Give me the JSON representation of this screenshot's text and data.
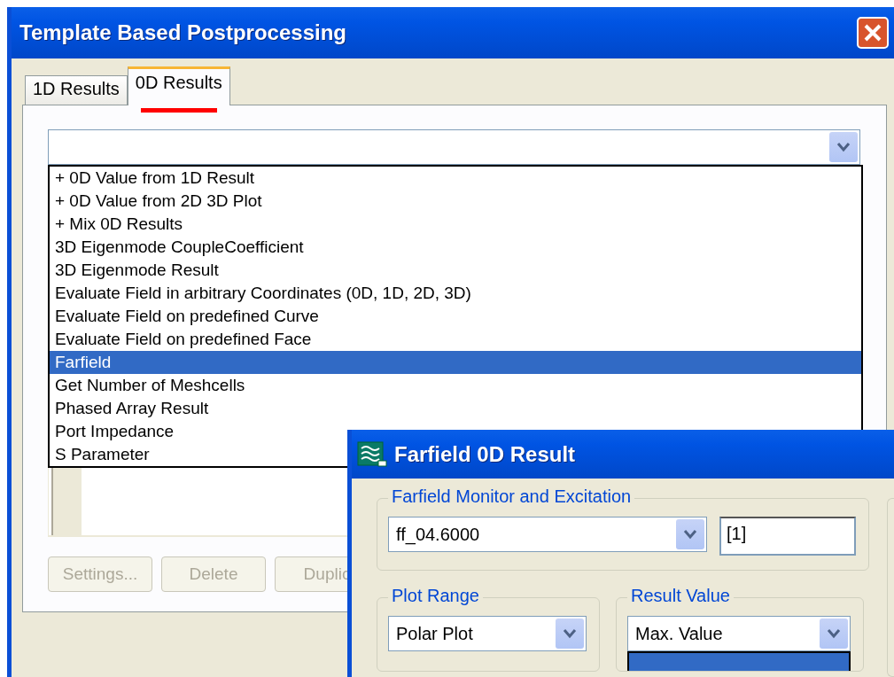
{
  "window": {
    "title": "Template Based Postprocessing"
  },
  "tabs": [
    {
      "label": "1D Results",
      "selected": false,
      "marked": false
    },
    {
      "label": "0D Results",
      "selected": true,
      "marked": true
    }
  ],
  "template_combo": {
    "expanded": true,
    "items": [
      {
        "label": "+ 0D Value from 1D Result",
        "selected": false
      },
      {
        "label": "+ 0D Value from 2D 3D Plot",
        "selected": false
      },
      {
        "label": "+ Mix 0D Results",
        "selected": false
      },
      {
        "label": "3D Eigenmode CoupleCoefficient",
        "selected": false
      },
      {
        "label": "3D Eigenmode Result",
        "selected": false
      },
      {
        "label": "Evaluate Field in arbitrary Coordinates (0D, 1D, 2D, 3D)",
        "selected": false
      },
      {
        "label": "Evaluate Field on predefined Curve",
        "selected": false
      },
      {
        "label": "Evaluate Field on predefined Face",
        "selected": false
      },
      {
        "label": "Farfield",
        "selected": true
      },
      {
        "label": "Get Number of Meshcells",
        "selected": false
      },
      {
        "label": "Phased Array Result",
        "selected": false
      },
      {
        "label": "Port Impedance",
        "selected": false
      },
      {
        "label": "S Parameter",
        "selected": false
      }
    ]
  },
  "buttons": [
    {
      "label": "Settings...",
      "disabled": true
    },
    {
      "label": "Delete",
      "disabled": true
    },
    {
      "label": "Duplic",
      "disabled": true
    }
  ],
  "farfield_dialog": {
    "title": "Farfield 0D Result",
    "monitor_group": {
      "label": "Farfield Monitor and Excitation",
      "monitor": "ff_04.6000",
      "excitation": "[1]"
    },
    "plot_range_group": {
      "label": "Plot Range",
      "value": "Polar Plot"
    },
    "result_value_group": {
      "label": "Result Value",
      "value": "Max. Value",
      "expanded": true
    }
  }
}
